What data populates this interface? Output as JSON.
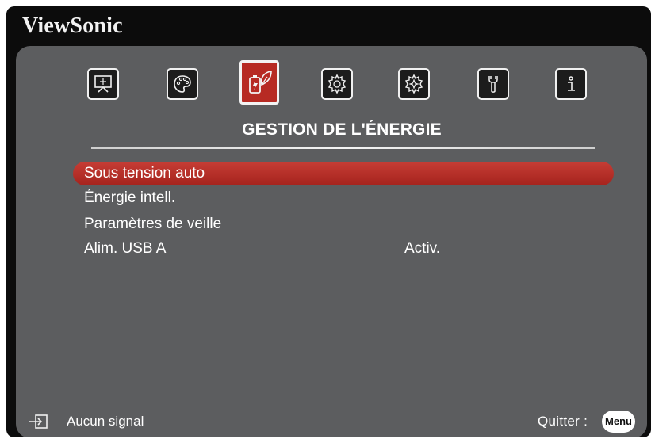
{
  "brand": {
    "name": "ViewSonic"
  },
  "tabs": [
    {
      "id": "display",
      "icon": "display-icon",
      "active": false
    },
    {
      "id": "picture",
      "icon": "palette-icon",
      "active": false
    },
    {
      "id": "power",
      "icon": "power-leaf-icon",
      "active": true
    },
    {
      "id": "basic",
      "icon": "gear-icon",
      "active": false
    },
    {
      "id": "advanced",
      "icon": "advanced-gear-icon",
      "active": false
    },
    {
      "id": "tools",
      "icon": "wrench-icon",
      "active": false
    },
    {
      "id": "info",
      "icon": "info-icon",
      "active": false
    }
  ],
  "section": {
    "title": "GESTION DE L'ÉNERGIE"
  },
  "menu": {
    "items": [
      {
        "label": "Sous tension auto",
        "value": "",
        "selected": true
      },
      {
        "label": "Énergie intell.",
        "value": "",
        "selected": false
      },
      {
        "label": "Paramètres de veille",
        "value": "",
        "selected": false
      },
      {
        "label": "Alim. USB A",
        "value": "Activ.",
        "selected": false
      }
    ]
  },
  "footer": {
    "signal_text": "Aucun signal",
    "quit_text": "Quitter :",
    "menu_button": "Menu"
  },
  "colors": {
    "panel": "#5c5d5f",
    "accent": "#b72a23",
    "outer": "#0c0c0c",
    "text": "#ffffff"
  }
}
